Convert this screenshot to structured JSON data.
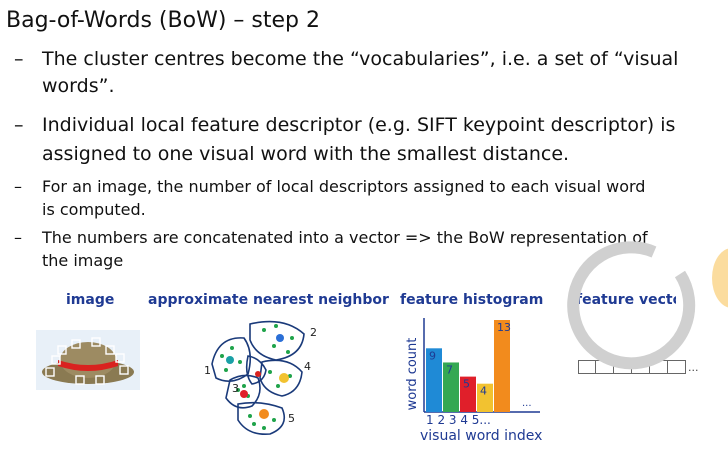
{
  "slide": {
    "title": "Bag-of-Words (BoW) – step 2",
    "bullets": [
      "The cluster centres become the “vocabularies”, i.e. a set of “visual words”.",
      "Individual local feature descriptor (e.g. SIFT keypoint descriptor) is assigned to one visual word with the smallest distance.",
      "For an image, the number of local descriptors assigned to each visual word is computed.",
      "The numbers are concatenated into a vector => the BoW representation of the image"
    ],
    "dash": "–"
  },
  "figure": {
    "labels": {
      "image": "image",
      "ann": "approximate nearest neighbor",
      "hist": "feature histogram",
      "vector": "feature vecto"
    },
    "cluster_numbers": [
      "1",
      "2",
      "3",
      "4",
      "5"
    ],
    "vector_ellipsis": "...",
    "histogram_ellipsis": "..."
  },
  "chart_data": {
    "type": "bar",
    "xlabel": "visual word index",
    "ylabel": "word count",
    "categories": [
      "1",
      "2",
      "3",
      "4",
      "5",
      "..."
    ],
    "tick_labels": "1 2 3 4 5...",
    "values": [
      9,
      7,
      5,
      4,
      13
    ],
    "bar_colors": [
      "#1f8ad6",
      "#34a853",
      "#e01f2a",
      "#f2c230",
      "#f28b1d"
    ]
  },
  "colors": {
    "accent": "#1f3a93",
    "spinner": "#d0d0d0"
  }
}
